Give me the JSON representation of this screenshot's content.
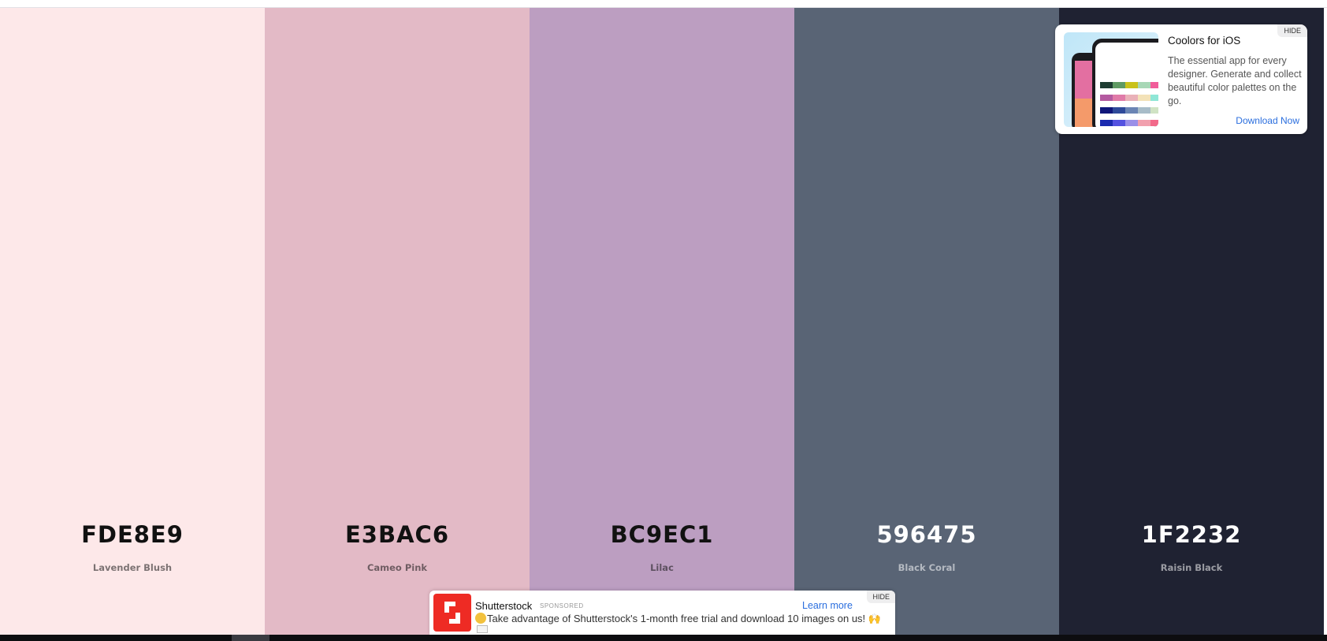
{
  "palette": {
    "swatches": [
      {
        "hex": "FDE8E9",
        "name": "Lavender Blush",
        "color": "#fde8e9",
        "text_color": "#111111"
      },
      {
        "hex": "E3BAC6",
        "name": "Cameo Pink",
        "color": "#e3bac6",
        "text_color": "#111111"
      },
      {
        "hex": "BC9EC1",
        "name": "Lilac",
        "color": "#bc9ec1",
        "text_color": "#111111"
      },
      {
        "hex": "596475",
        "name": "Black Coral",
        "color": "#596475",
        "text_color": "#ffffff"
      },
      {
        "hex": "1F2232",
        "name": "Raisin Black",
        "color": "#1f2232",
        "text_color": "#ffffff"
      }
    ]
  },
  "ios_ad": {
    "hide_label": "HIDE",
    "title": "Coolors for iOS",
    "description": "The essential app for every designer. Generate and collect beautiful color palettes on the go.",
    "cta": "Download Now",
    "image_icon": "phone-mockup-image"
  },
  "shutterstock_ad": {
    "hide_label": "HIDE",
    "brand": "Shutterstock",
    "sponsored": "SPONSORED",
    "learn_more": "Learn more",
    "message": "Take advantage of Shutterstock's 1-month free trial and download 10 images on us! 🙌",
    "logo_icon": "shutterstock-logo-icon"
  },
  "colors": {
    "link": "#2a6ede",
    "shutterstock_red": "#ee2b24"
  }
}
